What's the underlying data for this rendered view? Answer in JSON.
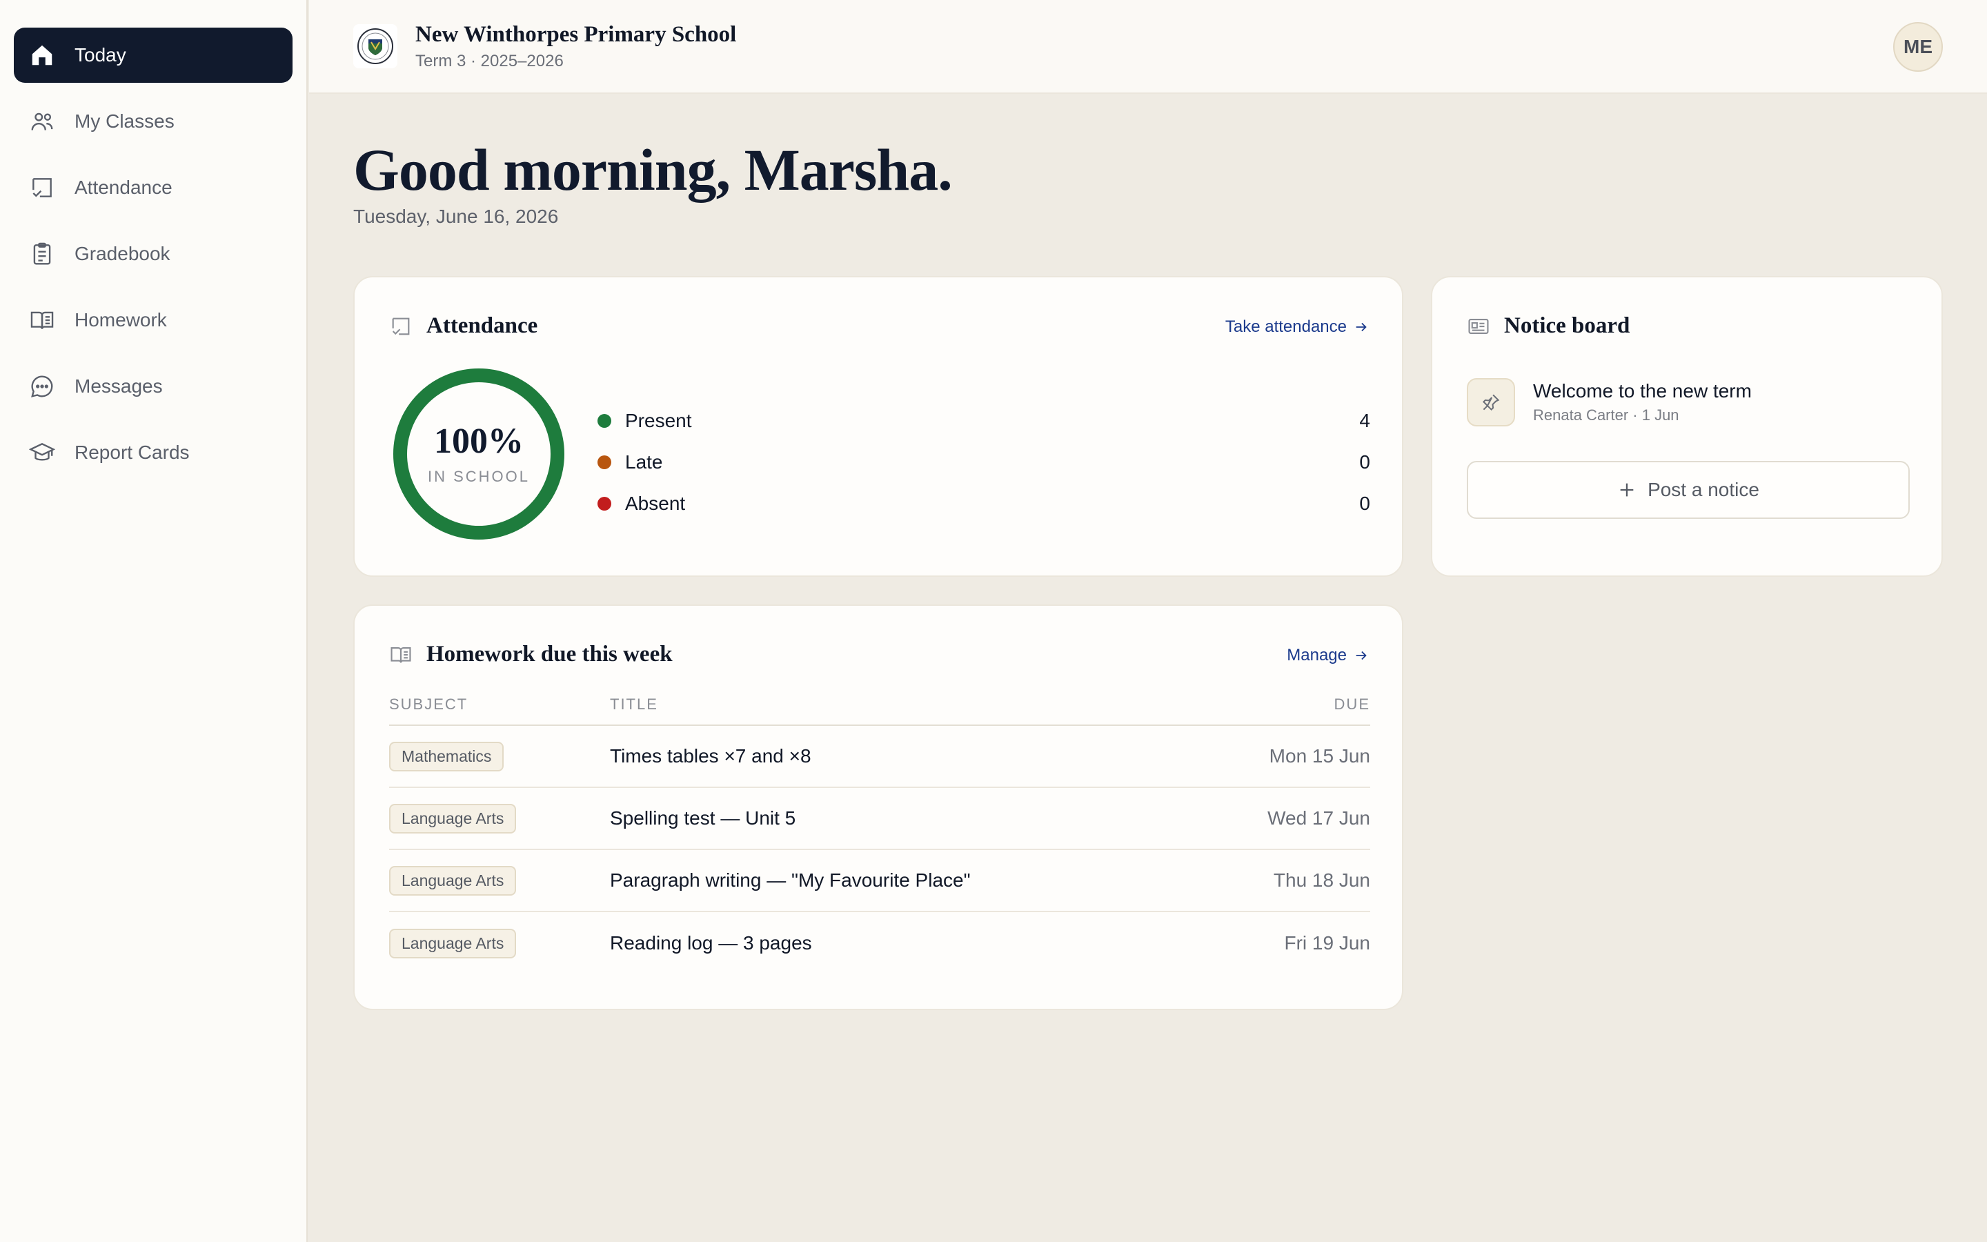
{
  "sidebar": {
    "items": [
      {
        "label": "Today",
        "icon": "home-icon",
        "active": true
      },
      {
        "label": "My Classes",
        "icon": "users-icon"
      },
      {
        "label": "Attendance",
        "icon": "attendance-icon"
      },
      {
        "label": "Gradebook",
        "icon": "clipboard-icon"
      },
      {
        "label": "Homework",
        "icon": "book-icon"
      },
      {
        "label": "Messages",
        "icon": "chat-icon"
      },
      {
        "label": "Report Cards",
        "icon": "graduation-cap-icon"
      }
    ]
  },
  "header": {
    "school_name": "New Winthorpes Primary School",
    "term": "Term 3 · 2025–2026",
    "avatar_initials": "ME"
  },
  "greeting": {
    "title": "Good morning, Marsha.",
    "date": "Tuesday, June 16, 2026"
  },
  "attendance": {
    "title": "Attendance",
    "link": "Take attendance",
    "percent": "100%",
    "percent_value": 1.0,
    "percent_label": "IN SCHOOL",
    "rows": [
      {
        "label": "Present",
        "count": "4",
        "color": "#1e7c3d"
      },
      {
        "label": "Late",
        "count": "0",
        "color": "#b8560f"
      },
      {
        "label": "Absent",
        "count": "0",
        "color": "#c21d1d"
      }
    ]
  },
  "notice_board": {
    "title": "Notice board",
    "notice": {
      "title": "Welcome to the new term",
      "meta": "Renata Carter · 1 Jun"
    },
    "post_button": "Post a notice"
  },
  "homework": {
    "title": "Homework due this week",
    "link": "Manage",
    "columns": {
      "subject": "SUBJECT",
      "title": "TITLE",
      "due": "DUE"
    },
    "rows": [
      {
        "subject": "Mathematics",
        "title": "Times tables ×7 and ×8",
        "due": "Mon 15 Jun"
      },
      {
        "subject": "Language Arts",
        "title": "Spelling test — Unit 5",
        "due": "Wed 17 Jun"
      },
      {
        "subject": "Language Arts",
        "title": "Paragraph writing — \"My Favourite Place\"",
        "due": "Thu 18 Jun"
      },
      {
        "subject": "Language Arts",
        "title": "Reading log — 3 pages",
        "due": "Fri 19 Jun"
      }
    ]
  },
  "colors": {
    "accent_navy": "#111a2d",
    "link_blue": "#1b3a8c",
    "present_green": "#1e7c3d"
  }
}
